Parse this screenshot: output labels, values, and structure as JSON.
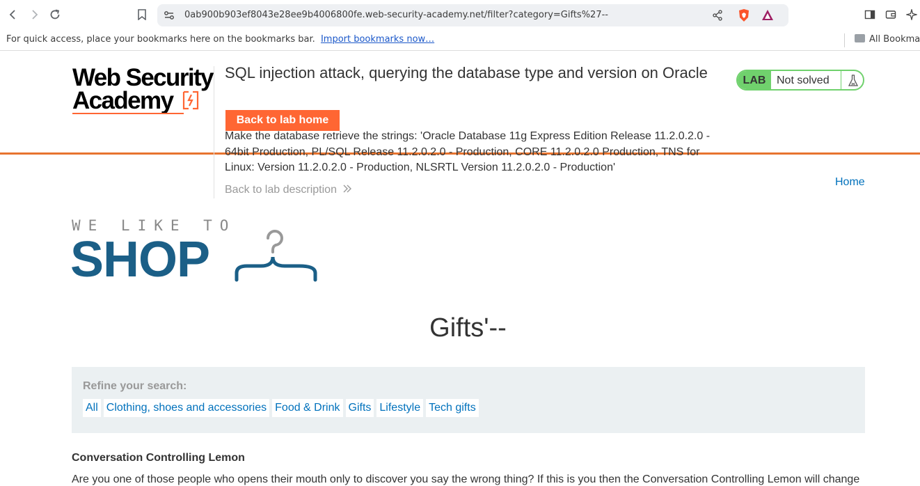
{
  "browser": {
    "url": "0ab900b903ef8043e28ee9b4006800fe.web-security-academy.net/filter?category=Gifts%27--",
    "bookmarks_message": "For quick access, place your bookmarks here on the bookmarks bar.",
    "import_link": "Import bookmarks now…",
    "all_bookmarks": "All Bookma"
  },
  "lab": {
    "logo_line1": "Web Security",
    "logo_line2": "Academy",
    "title": "SQL injection attack, querying the database type and version on Oracle",
    "back_button": "Back to lab home",
    "description": "Make the database retrieve the strings: 'Oracle Database 11g Express Edition Release 11.2.0.2.0 - 64bit Production, PL/SQL Release 11.2.0.2.0 - Production, CORE 11.2.0.2.0 Production, TNS for Linux: Version 11.2.0.2.0 - Production, NLSRTL Version 11.2.0.2.0 - Production'",
    "back_description": "Back to lab description",
    "status_badge": "LAB",
    "status_text": "Not solved",
    "home_link": "Home"
  },
  "shop": {
    "tagline": "WE LIKE TO",
    "brand": "SHOP",
    "heading": "Gifts'--",
    "refine_label": "Refine your search:",
    "categories": [
      "All",
      "Clothing, shoes and accessories",
      "Food & Drink",
      "Gifts",
      "Lifestyle",
      "Tech gifts"
    ],
    "product_name": "Conversation Controlling Lemon",
    "product_desc": "Are you one of those people who opens their mouth only to discover you say the wrong thing? If this is you then the Conversation Controlling Lemon will change"
  },
  "colors": {
    "accent_orange": "#ff6633",
    "shop_blue": "#1b5f87",
    "link_blue": "#0071bc",
    "status_green": "#70d16d"
  }
}
